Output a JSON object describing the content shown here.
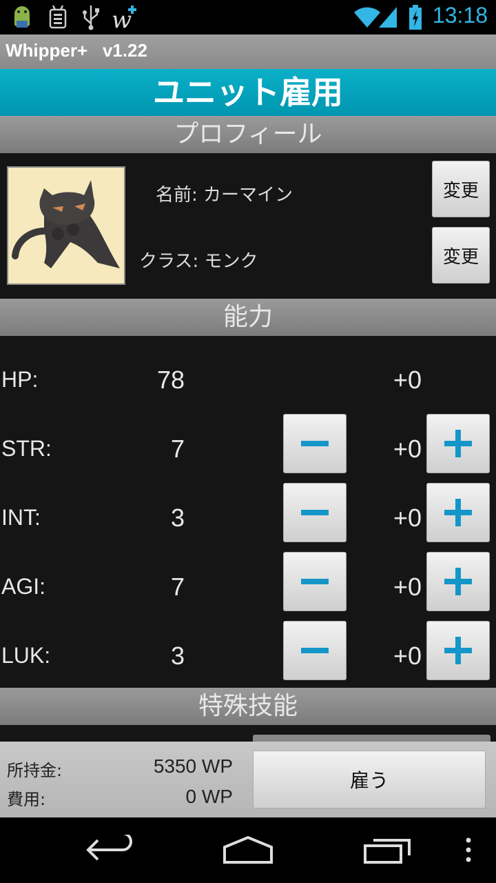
{
  "status_bar": {
    "time": "13:18",
    "icons": [
      "android-icon",
      "debug-icon",
      "usb-icon",
      "whipper-icon",
      "wifi-icon",
      "signal-icon",
      "battery-charging-icon"
    ],
    "accent": "#33b5e5"
  },
  "app": {
    "title": "Whipper+   v1.22"
  },
  "screen": {
    "title": "ユニット雇用"
  },
  "profile": {
    "header": "プロフィール",
    "name_label": "名前: カーマイン",
    "class_label": "クラス: モンク",
    "change_name_button": "変更",
    "change_class_button": "変更",
    "portrait": "black-cat-monk-portrait"
  },
  "abilities": {
    "header": "能力",
    "stats": [
      {
        "label": "HP:",
        "value": "78",
        "bonus": "+0"
      },
      {
        "label": "STR:",
        "value": "7",
        "bonus": "+0"
      },
      {
        "label": "INT:",
        "value": "3",
        "bonus": "+0"
      },
      {
        "label": "AGI:",
        "value": "7",
        "bonus": "+0"
      },
      {
        "label": "LUK:",
        "value": "3",
        "bonus": "+0"
      }
    ]
  },
  "skills": {
    "header": "特殊技能"
  },
  "footer": {
    "money_label": "所持金:",
    "money_value": "5350 WP",
    "cost_label": "費用:",
    "cost_value": "0 WP",
    "hire_button": "雇う"
  },
  "nav": {
    "icons": [
      "back-icon",
      "home-icon",
      "recent-apps-icon",
      "menu-icon"
    ]
  }
}
